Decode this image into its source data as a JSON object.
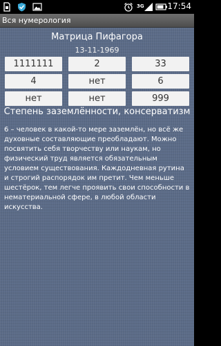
{
  "status_bar": {
    "time": "17:54",
    "network": "3G",
    "icons": [
      "sim-icon",
      "shield-icon",
      "image-icon",
      "alarm-icon",
      "signal-icon",
      "battery-icon"
    ]
  },
  "app": {
    "title": "Вся нумерология"
  },
  "matrix": {
    "title": "Матрица Пифагора",
    "date": "13-11-1969",
    "cells": [
      [
        "1111111",
        "2",
        "33"
      ],
      [
        "4",
        "нет",
        "6"
      ],
      [
        "нет",
        "нет",
        "999"
      ]
    ]
  },
  "section": {
    "title": "Степень заземлённости, консерватизм",
    "description": "6 – человек в какой-то мере заземлён, но всё же духовные составляющие преобладают. Можно посвятить себя творчеству или наукам, но физический труд является обязательным условием существования. Каждодневная рутина и строгий распорядок им претит. Чем меньше шестёрок, тем легче проявить свои способности в нематериальной сфере, в любой области искусства."
  },
  "colors": {
    "background": "#5b6b87",
    "cell": "#f2f2f2",
    "titlebar": "#5e5e5e"
  }
}
